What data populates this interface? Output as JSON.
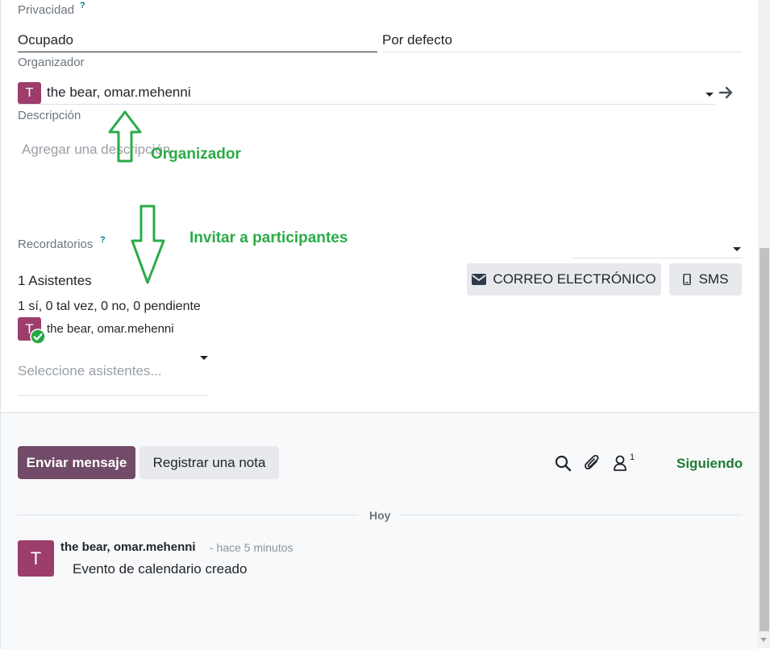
{
  "form": {
    "privacy": {
      "label": "Privacidad",
      "help": "?",
      "value": "Ocupado",
      "show_as": "Por defecto"
    },
    "organizer": {
      "label": "Organizador",
      "avatar_letter": "T",
      "value": "the bear, omar.mehenni"
    },
    "description": {
      "label": "Descripción",
      "placeholder": "Agregar una descripción"
    },
    "reminders": {
      "label": "Recordatorios",
      "help": "?"
    },
    "attendees": {
      "count_label": "1 Asistentes",
      "summary": "1 sí, 0 tal vez, 0 no, 0 pendiente",
      "items": [
        {
          "avatar_letter": "T",
          "name": "the bear, omar.mehenni",
          "status": "accepted"
        }
      ],
      "select_placeholder": "Seleccione asistentes..."
    },
    "buttons": {
      "email": "CORREO ELECTRÓNICO",
      "sms": "SMS"
    }
  },
  "annotations": {
    "organizer": "Organizador",
    "invite": "Invitar a participantes",
    "color": "#2bab47"
  },
  "chatter": {
    "send_message": "Enviar mensaje",
    "log_note": "Registrar una nota",
    "followers_count": "1",
    "following": "Siguiendo",
    "date_separator": "Hoy",
    "messages": [
      {
        "avatar_letter": "T",
        "author": "the bear, omar.mehenni",
        "time": "- hace 5 minutos",
        "body": "Evento de calendario creado"
      }
    ]
  },
  "colors": {
    "primary": "#714b67",
    "avatar": "#9c3d6b",
    "success": "#28a745",
    "following": "#1e7b34"
  }
}
